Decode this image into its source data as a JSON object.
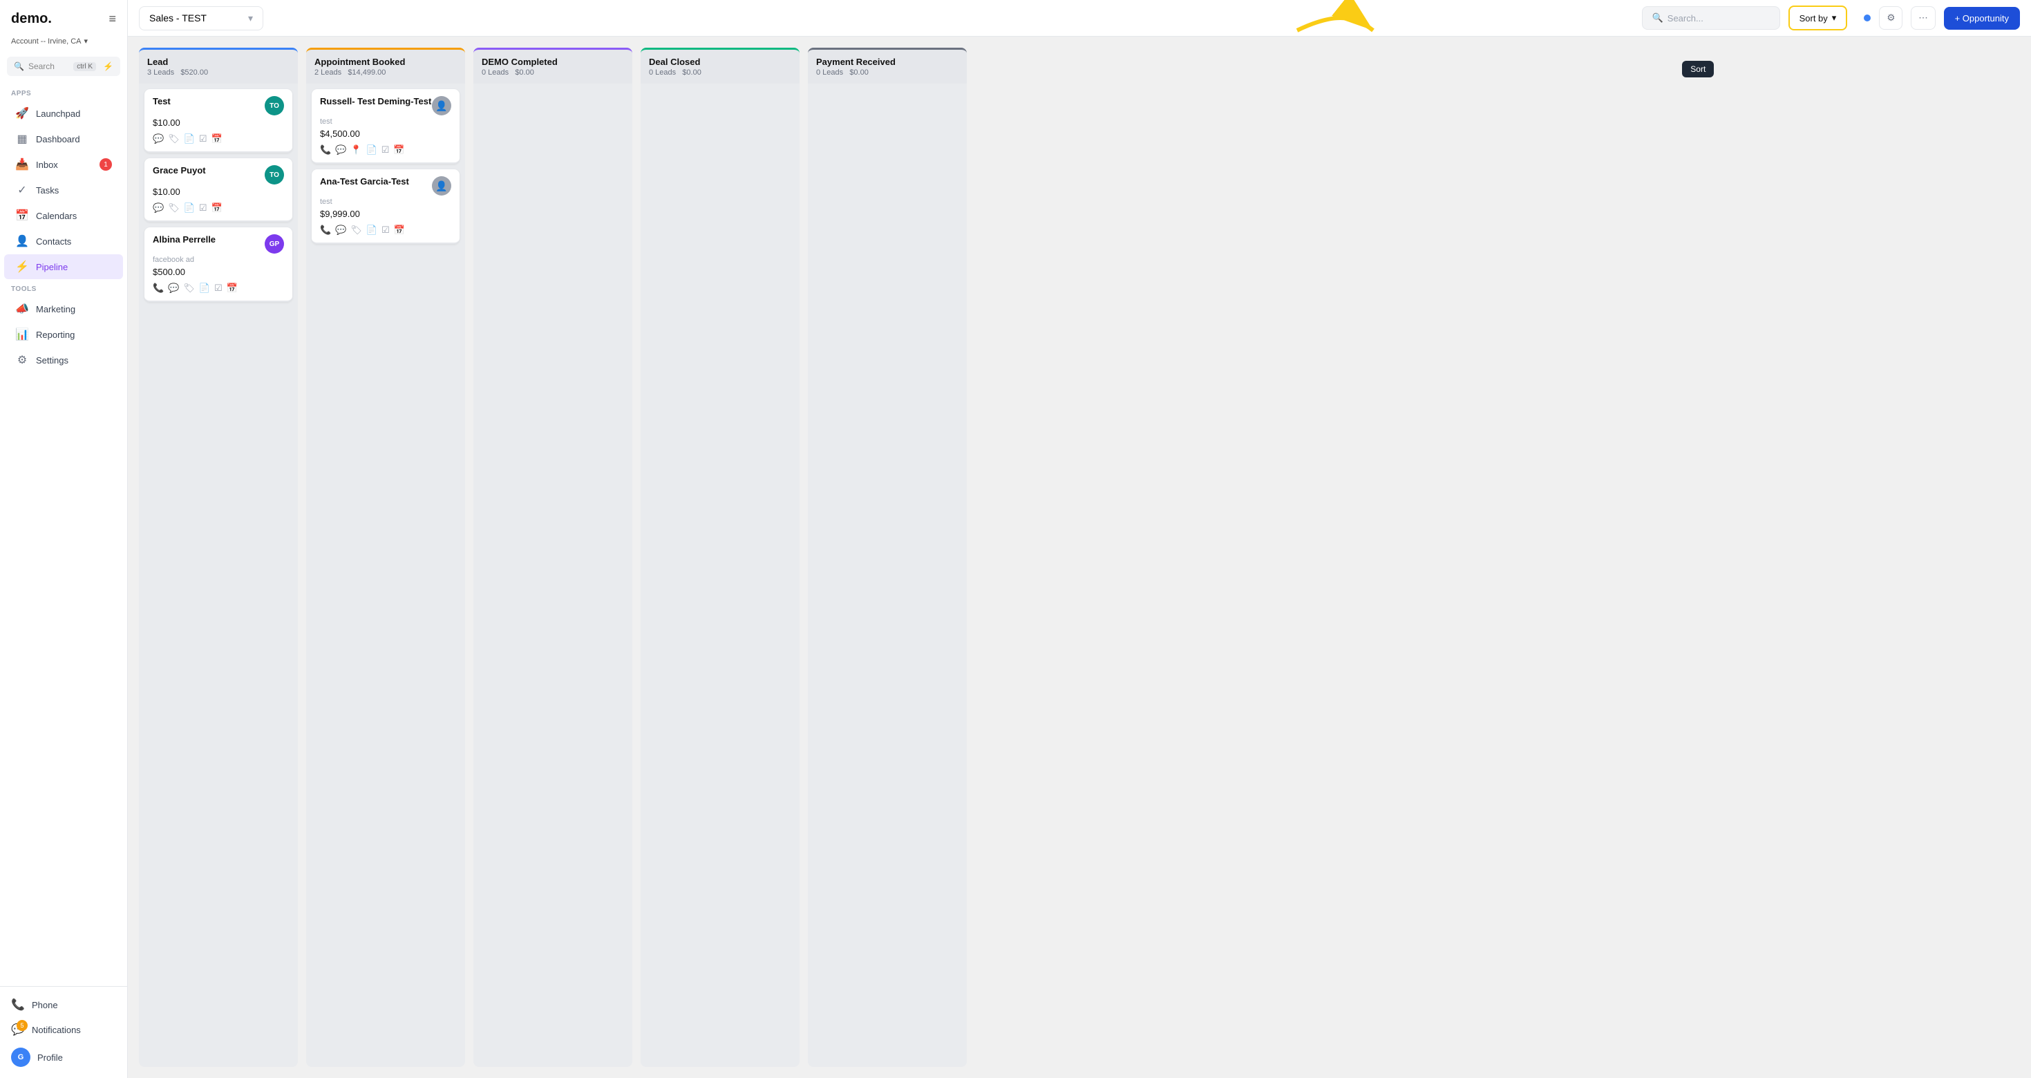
{
  "app": {
    "logo": "demo.",
    "account": "Account -- Irvine, CA"
  },
  "sidebar": {
    "search_label": "Search",
    "search_shortcut": "ctrl K",
    "sections": [
      {
        "label": "Apps",
        "items": [
          {
            "id": "launchpad",
            "label": "Launchpad",
            "icon": "🚀",
            "badge": null
          },
          {
            "id": "dashboard",
            "label": "Dashboard",
            "icon": "▦",
            "badge": null
          },
          {
            "id": "inbox",
            "label": "Inbox",
            "icon": "📥",
            "badge": "1"
          },
          {
            "id": "tasks",
            "label": "Tasks",
            "icon": "✓",
            "badge": null
          },
          {
            "id": "calendars",
            "label": "Calendars",
            "icon": "📅",
            "badge": null
          },
          {
            "id": "contacts",
            "label": "Contacts",
            "icon": "👤",
            "badge": null
          },
          {
            "id": "pipeline",
            "label": "Pipeline",
            "icon": "⚡",
            "badge": null,
            "active": true
          }
        ]
      },
      {
        "label": "Tools",
        "items": [
          {
            "id": "marketing",
            "label": "Marketing",
            "icon": "📣",
            "badge": null
          },
          {
            "id": "reporting",
            "label": "Reporting",
            "icon": "⚙",
            "badge": null
          },
          {
            "id": "settings",
            "label": "Settings",
            "icon": "⚙",
            "badge": null
          }
        ]
      }
    ],
    "bottom": [
      {
        "id": "phone",
        "label": "Phone",
        "icon": "📞"
      },
      {
        "id": "notifications",
        "label": "Notifications",
        "icon": "💬",
        "badge": "5"
      },
      {
        "id": "profile",
        "label": "Profile",
        "icon": "👤"
      }
    ]
  },
  "header": {
    "pipeline_name": "Sales - TEST",
    "search_placeholder": "Search...",
    "sort_by_label": "Sort by",
    "add_opportunity_label": "+ Opportunity",
    "sort_tooltip": "Sort"
  },
  "columns": [
    {
      "id": "lead",
      "title": "Lead",
      "leads_count": "3 Leads",
      "amount": "$520.00",
      "color_class": "lead-col",
      "cards": [
        {
          "name": "Test",
          "source": "",
          "amount": "$10.00",
          "avatar": "TO",
          "avatar_class": "avatar-to",
          "has_person_icon": false
        },
        {
          "name": "Grace Puyot",
          "source": "",
          "amount": "$10.00",
          "avatar": "TO",
          "avatar_class": "avatar-to",
          "has_person_icon": false
        },
        {
          "name": "Albina Perrelle",
          "source": "facebook ad",
          "amount": "$500.00",
          "avatar": "GP",
          "avatar_class": "avatar-gp",
          "has_person_icon": false
        }
      ]
    },
    {
      "id": "appointment",
      "title": "Appointment Booked",
      "leads_count": "2 Leads",
      "amount": "$14,499.00",
      "color_class": "appt-col",
      "cards": [
        {
          "name": "Russell- Test Deming-Test",
          "source": "test",
          "amount": "$4,500.00",
          "avatar": "",
          "avatar_class": "avatar-person",
          "has_person_icon": true,
          "has_location": true
        },
        {
          "name": "Ana-Test Garcia-Test",
          "source": "test",
          "amount": "$9,999.00",
          "avatar": "",
          "avatar_class": "avatar-person",
          "has_person_icon": true
        }
      ]
    },
    {
      "id": "demo",
      "title": "DEMO Completed",
      "leads_count": "0 Leads",
      "amount": "$0.00",
      "color_class": "demo-col",
      "cards": []
    },
    {
      "id": "deal",
      "title": "Deal Closed",
      "leads_count": "0 Leads",
      "amount": "$0.00",
      "color_class": "deal-col",
      "cards": []
    },
    {
      "id": "payment",
      "title": "Payment Received",
      "leads_count": "0 Leads",
      "amount": "$0.00",
      "color_class": "payment-col",
      "cards": []
    }
  ]
}
